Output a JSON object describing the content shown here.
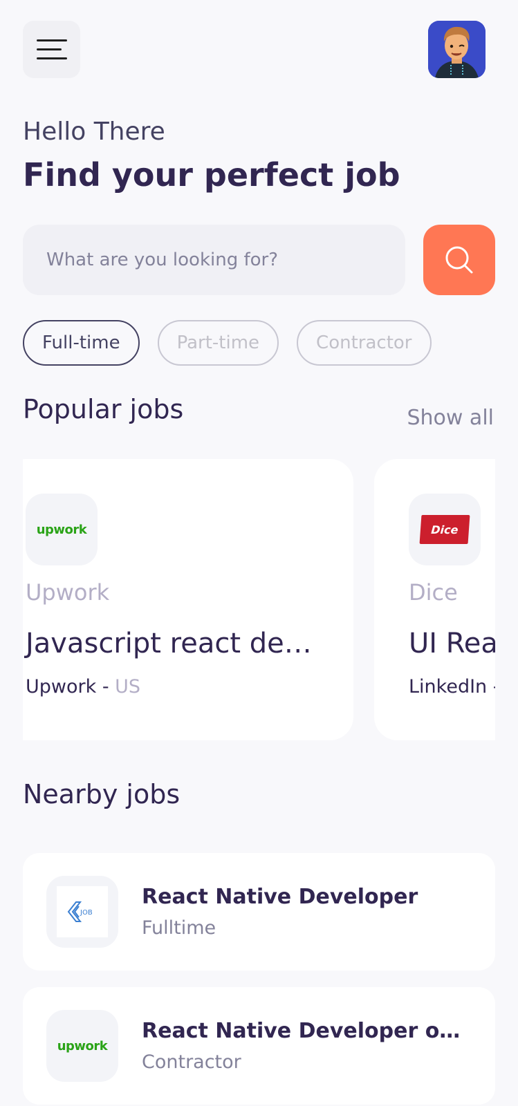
{
  "header": {
    "menu_icon": "hamburger-menu-icon",
    "avatar_icon": "user-avatar-icon"
  },
  "welcome": {
    "greeting": "Hello There",
    "headline": "Find your perfect job"
  },
  "search": {
    "placeholder": "What are you looking for?",
    "button_icon": "search-icon",
    "accent_color": "#ff7754"
  },
  "job_types": [
    {
      "label": "Full-time",
      "active": true
    },
    {
      "label": "Part-time",
      "active": false
    },
    {
      "label": "Contractor",
      "active": false
    }
  ],
  "popular": {
    "title": "Popular jobs",
    "show_all": "Show all",
    "cards": [
      {
        "logo_text": "upwork",
        "company": "Upwork",
        "title": "Javascript react de…",
        "publisher": "Upwork",
        "separator": " - ",
        "location": "US"
      },
      {
        "logo_text": "Dice",
        "company": "Dice",
        "title": "UI Reac",
        "publisher": "LinkedIn",
        "separator": " -",
        "location": ""
      }
    ]
  },
  "nearby": {
    "title": "Nearby jobs",
    "items": [
      {
        "logo_text": "JOB",
        "title": "React Native Developer",
        "type": "Fulltime"
      },
      {
        "logo_text": "upwork",
        "title": "React Native Developer o…",
        "type": "Contractor"
      }
    ]
  }
}
